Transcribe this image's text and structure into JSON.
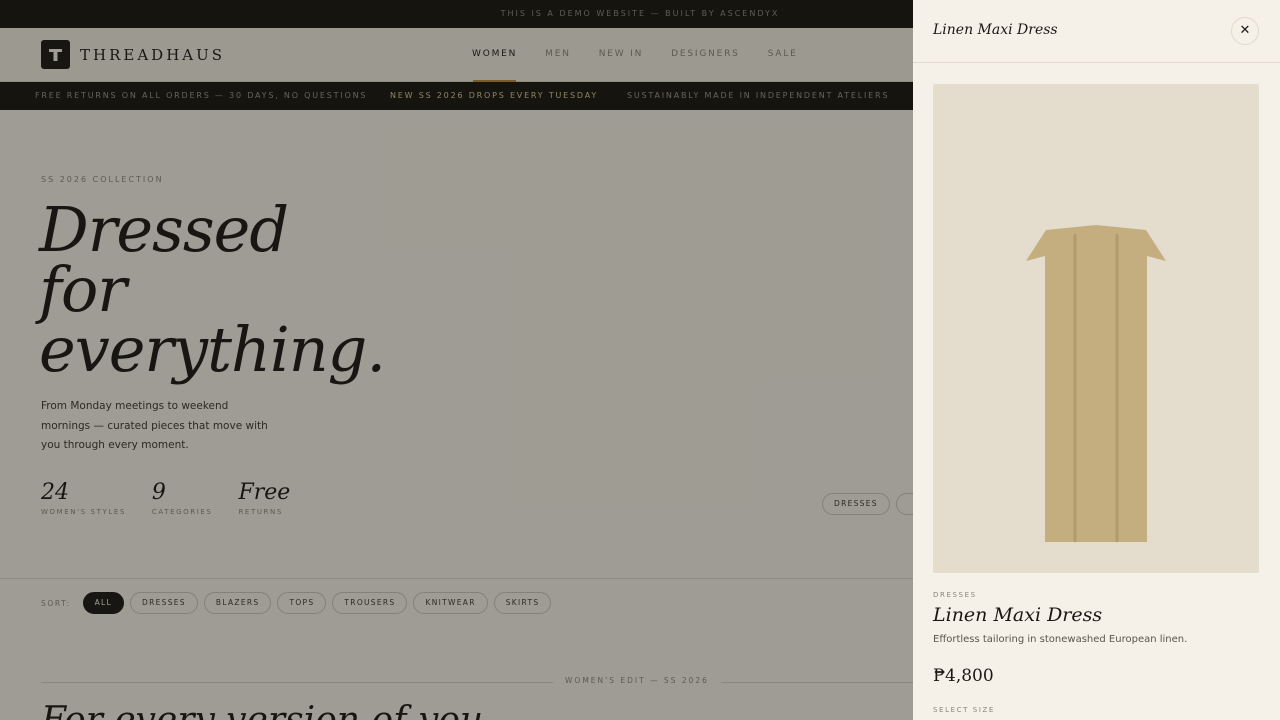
{
  "topbar": {
    "text": "This is a demo website — built by AscendyX"
  },
  "brand": {
    "name": "THREADHAUS",
    "icon": "logo-hanger-icon"
  },
  "nav": {
    "items": [
      "Women",
      "Men",
      "New In",
      "Designers",
      "Sale"
    ],
    "active": "Women"
  },
  "announcements": [
    "Free returns on all orders — 30 days, no questions",
    "New SS 2026 drops every Tuesday",
    "Sustainably made in independent ateliers"
  ],
  "hero": {
    "eyebrow": "SS 2026 Collection",
    "headline": [
      "Dressed",
      "for",
      "everything."
    ],
    "subcopy": "From Monday meetings to weekend mornings — curated pieces that move with you through every moment.",
    "stats": [
      {
        "value": "24",
        "label": "Women's styles"
      },
      {
        "value": "9",
        "label": "Categories"
      },
      {
        "value": "Free",
        "label": "Returns"
      }
    ],
    "pills": [
      "Dresses"
    ]
  },
  "sort": {
    "label": "Sort:",
    "options": [
      "All",
      "Dresses",
      "Blazers",
      "Tops",
      "Trousers",
      "Knitwear",
      "Skirts"
    ],
    "active": "All"
  },
  "edit": {
    "label": "Women's edit — SS 2026",
    "title": "For every version of you"
  },
  "panel": {
    "title": "Linen Maxi Dress",
    "close_icon": "close-icon",
    "category": "Dresses",
    "name": "Linen Maxi Dress",
    "description": "Effortless tailoring in stonewashed European linen.",
    "price": "₱4,800",
    "size_label": "Select size"
  },
  "colors": {
    "accent": "#b8893a",
    "dark": "#16140f",
    "cream": "#f3efe6",
    "garment": "#c4ae80"
  }
}
